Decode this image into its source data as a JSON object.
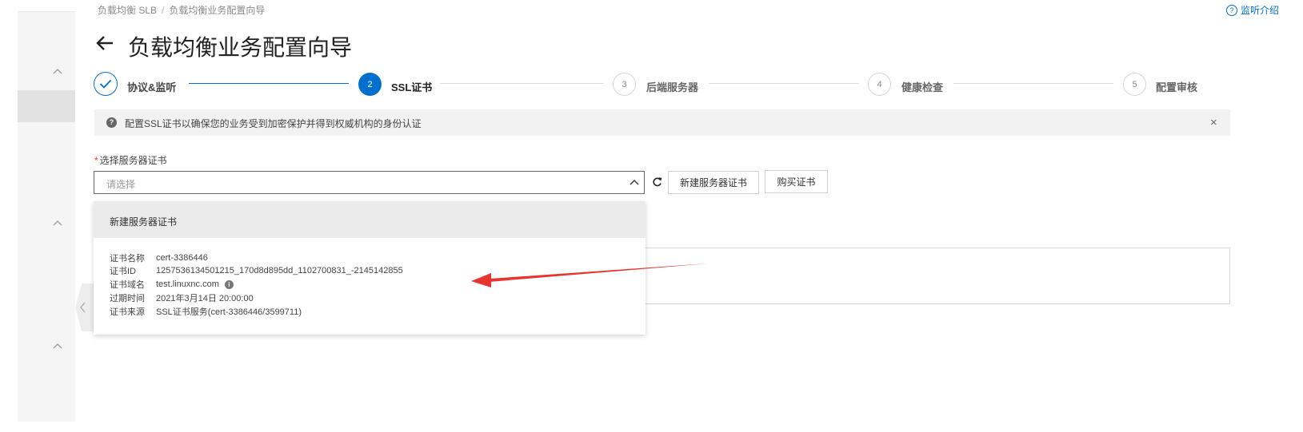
{
  "breadcrumb": [
    "负载均衡 SLB",
    "负载均衡业务配置向导"
  ],
  "header": {
    "help_link": "监听介绍",
    "title": "负载均衡业务配置向导"
  },
  "steps": [
    {
      "number": "1",
      "label": "协议&监听",
      "state": "done"
    },
    {
      "number": "2",
      "label": "SSL证书",
      "state": "active"
    },
    {
      "number": "3",
      "label": "后端服务器",
      "state": "todo"
    },
    {
      "number": "4",
      "label": "健康检查",
      "state": "todo"
    },
    {
      "number": "5",
      "label": "配置审核",
      "state": "todo"
    }
  ],
  "tip": {
    "text": "配置SSL证书以确保您的业务受到加密保护并得到权威机构的身份认证",
    "close": "×"
  },
  "form": {
    "required_mark": "*",
    "label": "选择服务器证书",
    "placeholder": "请选择",
    "new_cert_button": "新建服务器证书",
    "buy_cert_button": "购买证书"
  },
  "dropdown": {
    "new_option": "新建服务器证书",
    "cert": [
      {
        "key": "证书名称",
        "value": "cert-3386446"
      },
      {
        "key": "证书ID",
        "value": "1257536134501215_170d8d895dd_1102700831_-2145142855"
      },
      {
        "key": "证书域名",
        "value": "test.linuxnc.com"
      },
      {
        "key": "过期时间",
        "value": "2021年3月14日 20:00:00"
      },
      {
        "key": "证书来源",
        "value": "SSL证书服务(cert-3386446/3599711)"
      }
    ]
  },
  "colors": {
    "accent": "#0070cc",
    "annotation_arrow": "#e8342f",
    "required": "#e4393c"
  },
  "icons": {
    "back": "arrow-left-icon",
    "done_step": "check-icon",
    "tip": "question-circle-icon",
    "close": "close-icon",
    "select": "chevron-up-icon",
    "refresh": "refresh-icon",
    "info": "info-circle-icon",
    "sidebar": "chevron-up-icon",
    "collapse": "chevron-left-icon"
  }
}
